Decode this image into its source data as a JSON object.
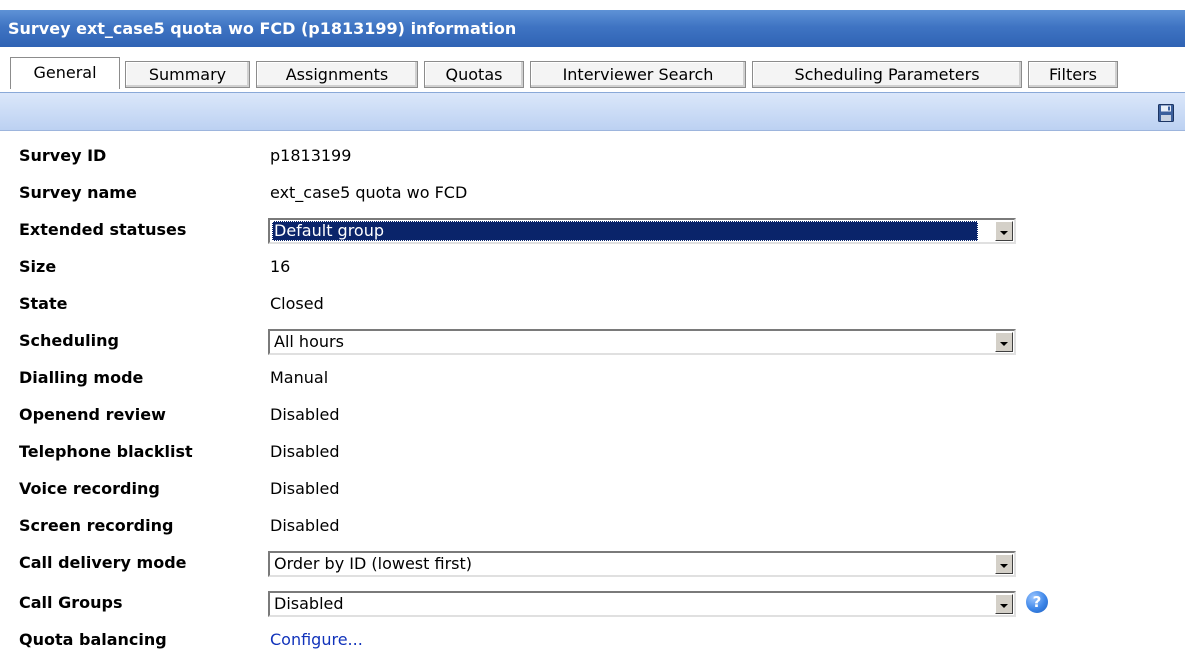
{
  "window": {
    "title": "Survey ext_case5 quota wo FCD (p1813199) information"
  },
  "tabs": [
    {
      "label": "General",
      "active": true
    },
    {
      "label": "Summary"
    },
    {
      "label": "Assignments"
    },
    {
      "label": "Quotas"
    },
    {
      "label": "Interviewer Search"
    },
    {
      "label": "Scheduling Parameters"
    },
    {
      "label": "Filters"
    }
  ],
  "toolbar": {
    "save_icon": "floppy-disk-save-icon"
  },
  "fields": {
    "survey_id": {
      "label": "Survey ID",
      "value": "p1813199"
    },
    "survey_name": {
      "label": "Survey name",
      "value": "ext_case5 quota wo FCD"
    },
    "extended_statuses": {
      "label": "Extended statuses",
      "value": "Default group"
    },
    "size": {
      "label": "Size",
      "value": "16"
    },
    "state": {
      "label": "State",
      "value": "Closed"
    },
    "scheduling": {
      "label": "Scheduling",
      "value": "All hours"
    },
    "dialling_mode": {
      "label": "Dialling mode",
      "value": "Manual"
    },
    "openend_review": {
      "label": "Openend review",
      "value": "Disabled"
    },
    "telephone_blacklist": {
      "label": "Telephone blacklist",
      "value": "Disabled"
    },
    "voice_recording": {
      "label": "Voice recording",
      "value": "Disabled"
    },
    "screen_recording": {
      "label": "Screen recording",
      "value": "Disabled"
    },
    "call_delivery_mode": {
      "label": "Call delivery mode",
      "value": "Order by ID (lowest first)"
    },
    "call_groups": {
      "label": "Call Groups",
      "value": "Disabled",
      "help": "?"
    },
    "quota_balancing": {
      "label": "Quota balancing",
      "value": "Configure..."
    }
  },
  "colors": {
    "titlebar": "#3f74c3",
    "toolbar": "#c6d8f5",
    "selected_option": "#0a246a",
    "link": "#1133bb"
  }
}
